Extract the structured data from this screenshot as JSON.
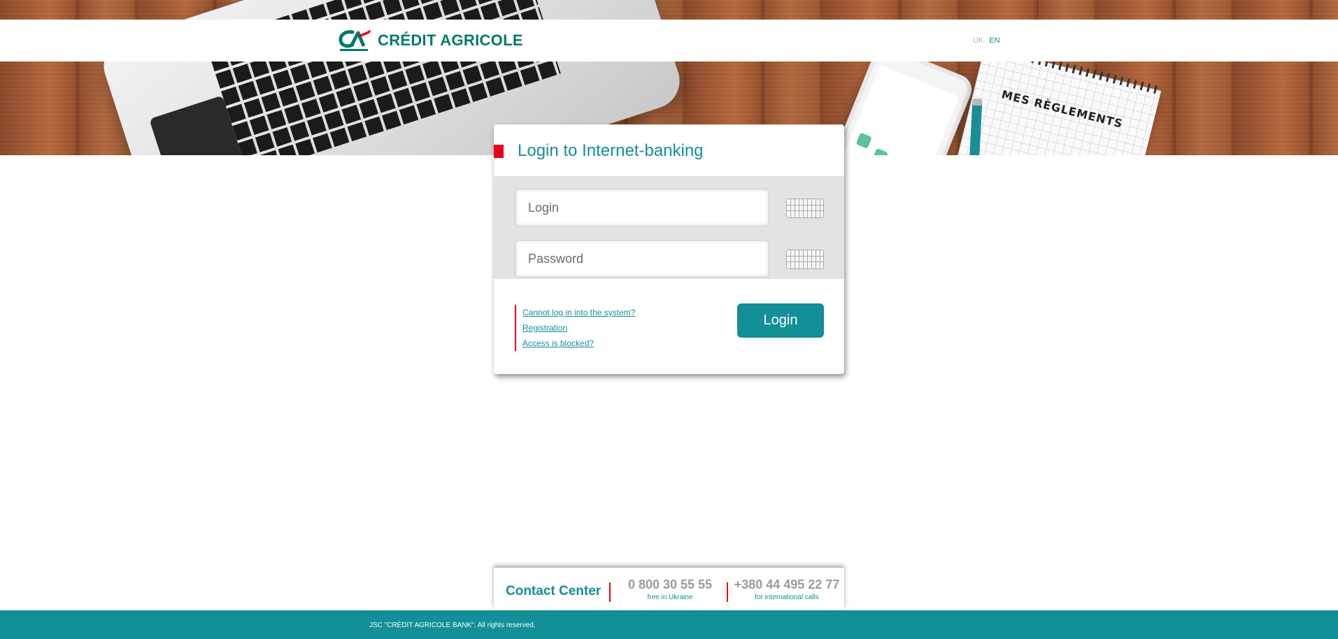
{
  "brand": {
    "name": "CRÉDIT AGRICOLE",
    "logo_icon": "ca-logo-icon",
    "primary_color": "#138f97",
    "accent_color": "#e8001b"
  },
  "header": {
    "languages": [
      "UK",
      "EN"
    ],
    "active_language": "EN"
  },
  "login_card": {
    "title": "Login to Internet-banking",
    "login_placeholder": "Login",
    "password_placeholder": "Password",
    "keyboard_icon": "virtual-keyboard-icon",
    "links": [
      "Cannot log in into the system?",
      "Registration",
      "Access is blocked?"
    ],
    "submit_label": "Login"
  },
  "contact": {
    "title": "Contact Center",
    "phones": [
      {
        "number": "0 800 30 55 55",
        "note": "free in Ukraine"
      },
      {
        "number": "+380 44 495 22 77",
        "note": "for international calls"
      }
    ]
  },
  "footer": {
    "copyright": "JSC \"CRÉDIT AGRICOLE BANK\". All rights reserved."
  }
}
